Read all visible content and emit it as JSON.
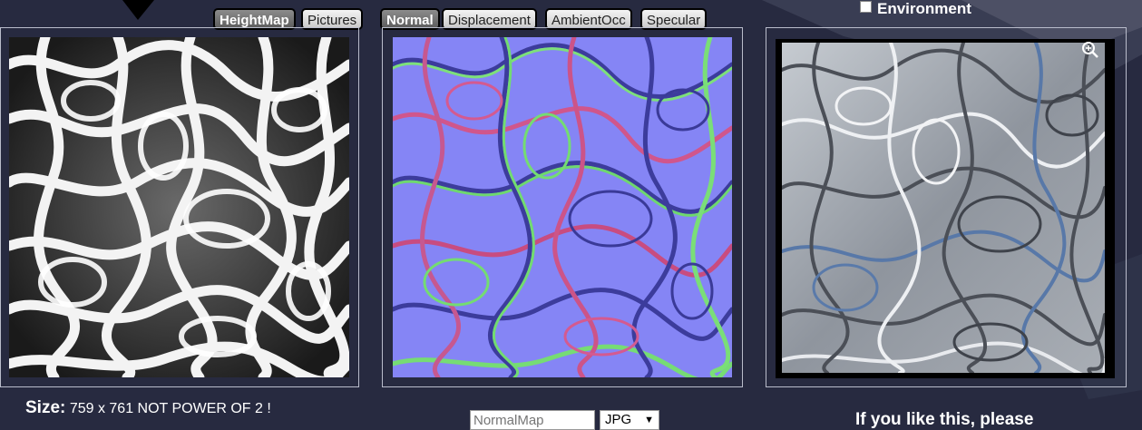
{
  "tabs_left": [
    {
      "label": "HeightMap",
      "active": true
    },
    {
      "label": "Pictures",
      "active": false
    }
  ],
  "tabs_right": [
    {
      "label": "Normal",
      "active": true
    },
    {
      "label": "Displacement",
      "active": false
    },
    {
      "label": "AmbientOcc",
      "active": false
    },
    {
      "label": "Specular",
      "active": false
    }
  ],
  "environment": {
    "label": "Environment",
    "checked": false
  },
  "size": {
    "label": "Size:",
    "value": "759 x 761 NOT POWER OF 2 !"
  },
  "filename_input": {
    "placeholder": "NormalMap",
    "value": ""
  },
  "format_select": {
    "selected": "JPG"
  },
  "promo_text": "If you like this, please",
  "icons": {
    "zoom": "zoom-in-icon",
    "dropdown": "chevron-down-icon"
  },
  "colors": {
    "background": "#272a40",
    "normal_map_base": "#8080ff",
    "active_tab": "#6e6e6e"
  }
}
